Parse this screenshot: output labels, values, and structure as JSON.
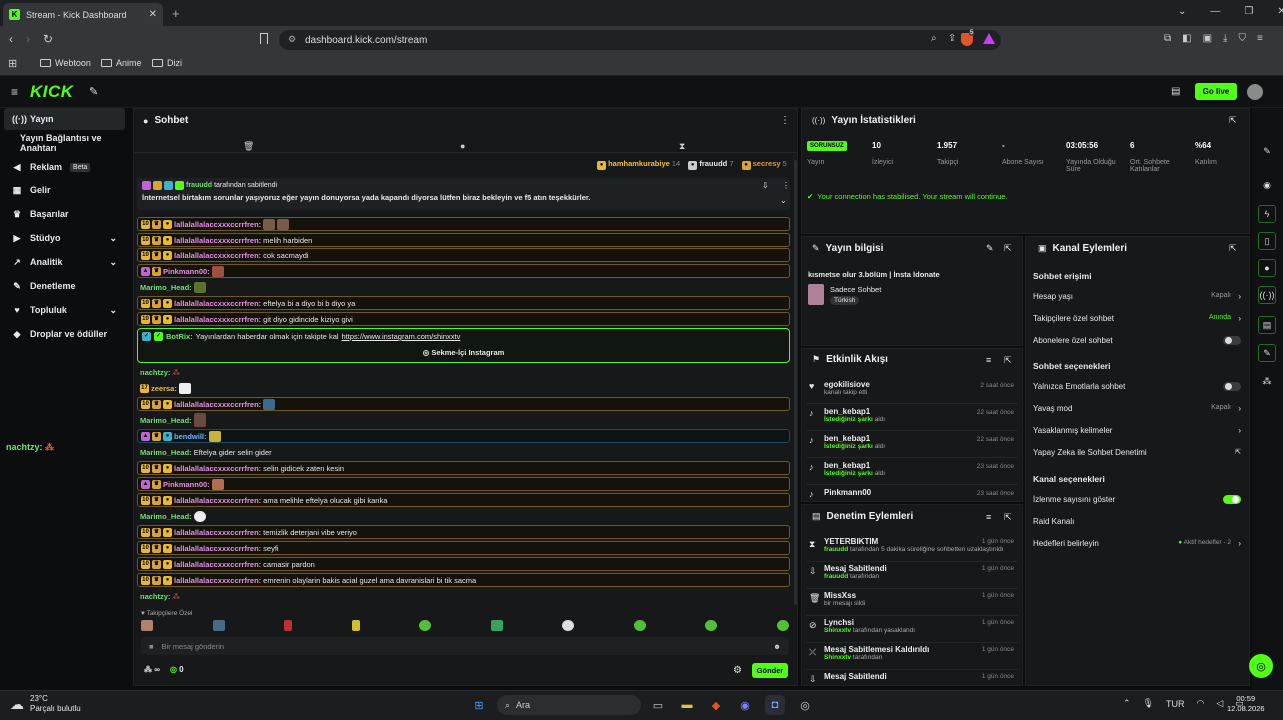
{
  "browser": {
    "tab_title": "Stream - Kick Dashboard",
    "url": "dashboard.kick.com/stream",
    "bookmarks": [
      "Webtoon",
      "Anime",
      "Dizi"
    ],
    "shield_count": "5"
  },
  "header": {
    "logo": "KICK",
    "go_live": "Go live"
  },
  "sidebar": {
    "items": [
      {
        "label": "Yayın",
        "icon": "broadcast-icon"
      },
      {
        "label": "Yayın Bağlantısı ve Anahtarı",
        "icon": ""
      },
      {
        "label": "Reklam",
        "icon": "megaphone-icon",
        "badge": "Beta"
      },
      {
        "label": "Gelir",
        "icon": "revenue-icon"
      },
      {
        "label": "Başarılar",
        "icon": "trophy-icon"
      },
      {
        "label": "Stüdyo",
        "icon": "studio-icon"
      },
      {
        "label": "Analitik",
        "icon": "analytics-icon"
      },
      {
        "label": "Denetleme",
        "icon": "wrench-icon"
      },
      {
        "label": "Topluluk",
        "icon": "community-icon"
      },
      {
        "label": "Droplar ve ödüller",
        "icon": "gift-icon"
      }
    ],
    "overflow_user": "nachtzy:"
  },
  "chat": {
    "title": "Sohbet",
    "top_gifters": [
      {
        "name": "hamhamkurabiye",
        "count": "14"
      },
      {
        "name": "frauudd",
        "count": "7"
      },
      {
        "name": "secresy",
        "count": "5"
      }
    ],
    "pinned_by": "frauudd",
    "pinned_suffix": "tarafından sabitlendi",
    "pinned_text": "İnternetsel birtakım sorunlar yaşıyoruz eğer yayın donuyorsa yada kapandı diyorsa lütfen biraz bekleyin ve f5 atın teşekkürler.",
    "messages": [
      {
        "user": "lallalallalaccxxxccrrfren:",
        "text": "",
        "style": "gold",
        "color": "pink"
      },
      {
        "user": "lallalallalaccxxxccrrfren:",
        "text": "melih harbiden",
        "style": "gold",
        "color": "pink"
      },
      {
        "user": "lallalallalaccxxxccrrfren:",
        "text": "cok sacmaydi",
        "style": "gold",
        "color": "pink"
      },
      {
        "user": "Pinkmann00:",
        "text": "",
        "style": "gold",
        "color": "pink"
      },
      {
        "user": "Marimo_Head:",
        "text": "",
        "style": "plain",
        "color": "green"
      },
      {
        "user": "lallalallalaccxxxccrrfren:",
        "text": "eftelya bi a diyo bi b diyo ya",
        "style": "gold",
        "color": "pink"
      },
      {
        "user": "lallalallalaccxxxccrrfren:",
        "text": "git diyo gidincide kiziyo givi",
        "style": "gold",
        "color": "pink"
      }
    ],
    "bot": {
      "user": "BotRix:",
      "text": "Yayınlardan haberdar olmak için takipte kal",
      "link": "https://www.instagram.com/shinxxtv",
      "button": "Sekme-İçi Instagram"
    },
    "messages2": [
      {
        "user": "nachtzy:",
        "text": "",
        "style": "plain",
        "color": "green"
      },
      {
        "user": "zeersa:",
        "text": "",
        "style": "plain",
        "color": "yel"
      },
      {
        "user": "lallalallalaccxxxccrrfren:",
        "text": "",
        "style": "gold",
        "color": "pink"
      },
      {
        "user": "Marimo_Head:",
        "text": "",
        "style": "plain",
        "color": "green"
      },
      {
        "user": "bendwill:",
        "text": "",
        "style": "blue",
        "color": "blu"
      },
      {
        "user": "Marimo_Head:",
        "text": "Eftelya gider selin gider",
        "style": "plain",
        "color": "green"
      },
      {
        "user": "lallalallalaccxxxccrrfren:",
        "text": "selin gidicek zaten kesin",
        "style": "gold",
        "color": "pink"
      },
      {
        "user": "Pinkmann00:",
        "text": "",
        "style": "gold",
        "color": "pink"
      },
      {
        "user": "lallalallalaccxxxccrrfren:",
        "text": "ama melihle eftelya olucak gibi kanka",
        "style": "gold",
        "color": "pink"
      },
      {
        "user": "Marimo_Head:",
        "text": "",
        "style": "plain",
        "color": "green"
      },
      {
        "user": "lallalallalaccxxxccrrfren:",
        "text": "temizlik deterjani vibe veriyo",
        "style": "gold",
        "color": "pink"
      },
      {
        "user": "lallalallalaccxxxccrrfren:",
        "text": "seyfi",
        "style": "gold",
        "color": "pink"
      },
      {
        "user": "lallalallalaccxxxccrrfren:",
        "text": "camasir pardon",
        "style": "gold",
        "color": "pink"
      },
      {
        "user": "lallalallalaccxxxccrrfren:",
        "text": "emrenin olaylarin bakis acial guzel ama davranislari bi tik sacma",
        "style": "gold",
        "color": "pink"
      },
      {
        "user": "nachtzy:",
        "text": "",
        "style": "plain",
        "color": "green"
      }
    ],
    "followers_only": "Takipçilere Özel",
    "input_placeholder": "Bir mesaj gönderin",
    "infinite": "∞",
    "points": "0",
    "send": "Gönder"
  },
  "stats": {
    "title": "Yayın İstatistikleri",
    "items": [
      {
        "value": "SORUNSUZ",
        "label": "Yayın"
      },
      {
        "value": "10",
        "label": "İzleyici"
      },
      {
        "value": "1.957",
        "label": "Takipçi"
      },
      {
        "value": "-",
        "label": "Abone Sayısı"
      },
      {
        "value": "03:05:56",
        "label": "Yayında Olduğu Süre"
      },
      {
        "value": "6",
        "label": "Ort. Sohbete Katılanlar"
      },
      {
        "value": "%64",
        "label": "Katılım"
      }
    ],
    "status_msg": "Your connection has stabilised. Your stream will continue."
  },
  "stream_info": {
    "title": "Yayın bilgisi",
    "stream_title": "kısmetse olur 3.bölüm | İnsta ldonate",
    "category": "Sadece Sohbet",
    "language": "Türkish"
  },
  "activity": {
    "title": "Etkinlik Akışı",
    "items": [
      {
        "user": "egokilisiove",
        "sub": "kanalı takip etti",
        "hl": "",
        "time": "2 saat önce"
      },
      {
        "user": "ben_kebap1",
        "sub": "aldı",
        "hl": "İstediğiniz şarkı",
        "time": "22 saat önce"
      },
      {
        "user": "ben_kebap1",
        "sub": "aldı",
        "hl": "İstediğiniz şarkı",
        "time": "22 saat önce"
      },
      {
        "user": "ben_kebap1",
        "sub": "aldı",
        "hl": "İstediğiniz şarkı",
        "time": "23 saat önce"
      },
      {
        "user": "Pinkmann00",
        "sub": "",
        "hl": "",
        "time": "23 saat önce"
      }
    ]
  },
  "moderation": {
    "title": "Denetim Eylemleri",
    "items": [
      {
        "user": "YETERBIKTIM",
        "hl": "frauudd",
        "sub": "tarafından 5 dakika süreliğine sohbetten uzaklaştırıldı",
        "time": "1 gün önce"
      },
      {
        "user": "Mesaj Sabitlendi",
        "hl": "frauudd",
        "sub": "tarafından",
        "time": "1 gün önce"
      },
      {
        "user": "MissXss",
        "hl": "",
        "sub": "bir mesajı sildi",
        "time": "1 gün önce"
      },
      {
        "user": "Lynchsi",
        "hl": "Shinxxtv",
        "sub": "tarafından yasaklandı",
        "time": "1 gün önce"
      },
      {
        "user": "Mesaj Sabitlemesi Kaldırıldı",
        "hl": "Shinxxtv",
        "sub": "tarafından",
        "time": "1 gün önce"
      },
      {
        "user": "Mesaj Sabitlendi",
        "hl": "",
        "sub": "",
        "time": "1 gün önce"
      }
    ]
  },
  "channel": {
    "title": "Kanal Eylemleri",
    "chat_access": "Sohbet erişimi",
    "hesap_yasi": "Hesap yaşı",
    "hesap_yasi_val": "Kapalı",
    "followers_only": "Takipçilere özel sohbet",
    "followers_only_val": "Anında",
    "subs_only": "Abonelere özel sohbet",
    "chat_options": "Sohbet seçenekleri",
    "emotes_only": "Yalnızca Emotlarla sohbet",
    "slow_mode": "Yavaş mod",
    "slow_mode_val": "Kapalı",
    "banned_words": "Yasaklanmış kelimeler",
    "ai_mod": "Yapay Zeka ile Sohbet Denetimi",
    "channel_options": "Kanal seçenekleri",
    "show_viewers": "İzlenme sayısını göster",
    "raid": "Raid Kanalı",
    "goals": "Hedefleri belirleyin",
    "goals_val": "Aktif hedefler - 2"
  },
  "taskbar": {
    "temp": "23°C",
    "weather": "Parçalı bulutlu",
    "search": "Ara",
    "lang": "TUR",
    "time": "00:59",
    "date": "12.08.2026"
  }
}
